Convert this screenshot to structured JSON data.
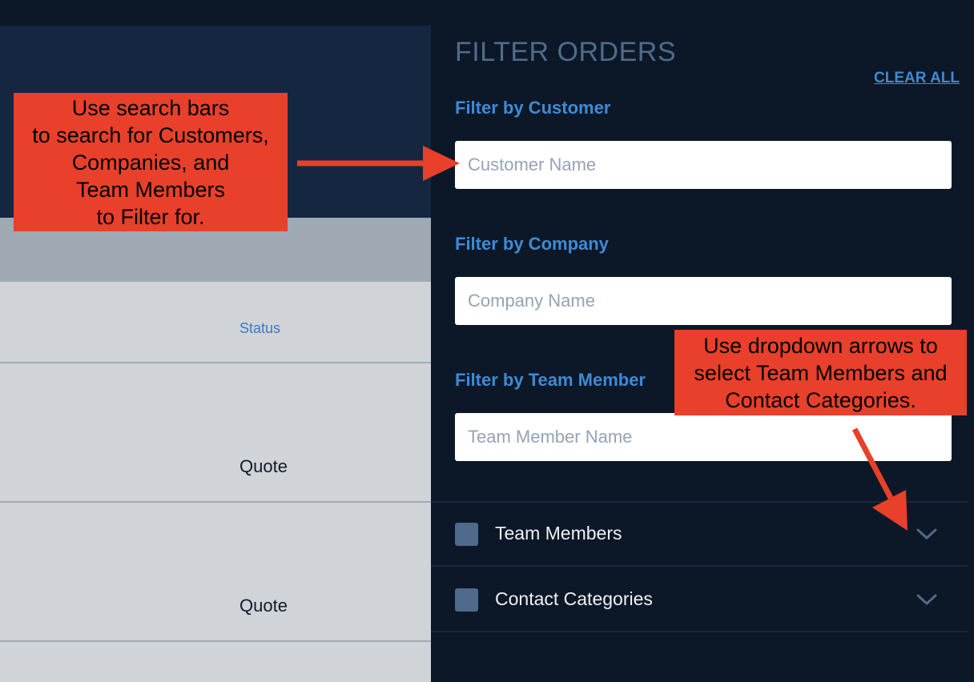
{
  "orders": {
    "status_header": "Status",
    "rows": [
      {
        "status": "Quote"
      },
      {
        "status": "Quote"
      }
    ]
  },
  "filter_panel": {
    "title": "FILTER ORDERS",
    "clear_all": "CLEAR ALL",
    "customer": {
      "label": "Filter by Customer",
      "placeholder": "Customer Name",
      "value": ""
    },
    "company": {
      "label": "Filter by Company",
      "placeholder": "Company Name",
      "value": ""
    },
    "team_member": {
      "label": "Filter by Team Member",
      "placeholder": "Team Member Name",
      "value": ""
    },
    "categories": [
      {
        "label": "Team Members",
        "icon": "chevron-down-icon"
      },
      {
        "label": "Contact Categories",
        "icon": "chevron-down-icon"
      }
    ]
  },
  "annotations": {
    "search_note": "Use search bars\nto search for Customers,\nCompanies, and\nTeam Members\nto Filter for.",
    "dropdown_note": "Use dropdown arrows to\nselect Team Members and\nContact Categories."
  },
  "colors": {
    "panel_bg": "#0c1827",
    "accent": "#3f8ad6",
    "annotation": "#e8402a"
  }
}
